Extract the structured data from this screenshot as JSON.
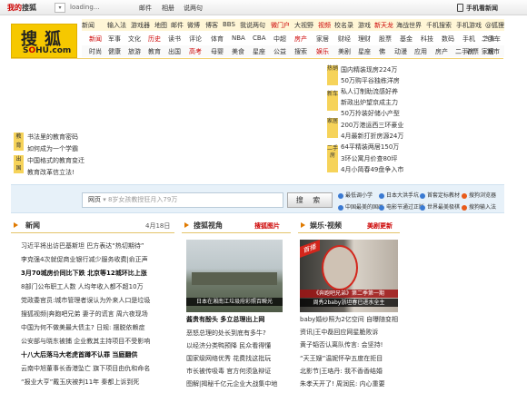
{
  "topbar": {
    "brand_red": "我的",
    "brand": "搜狐",
    "dropdown": "▾",
    "loading": "loading...",
    "links": [
      "邮件",
      "相册",
      "说两句"
    ],
    "mobile": "手机看新闻"
  },
  "logo": {
    "cn": "搜狐",
    "en_pre": "S",
    "en_o": "O",
    "en_post": "HU.com"
  },
  "nav": {
    "row1": [
      "新闻",
      "输入法",
      "游戏器",
      "地图",
      "邮件",
      "微博",
      "博客",
      "BBS",
      "我说两句",
      "微门户",
      "大视野",
      "视频",
      "校名录",
      "游戏",
      "新天龙",
      "海战世界",
      "千机搜索",
      "手机游戏",
      "@狐狸"
    ],
    "row2": [
      "新闻",
      "军事",
      "文化",
      "历史",
      "读书",
      "评论",
      "体育",
      "NBA",
      "CBA",
      "中超",
      "房产",
      "家居",
      "财经",
      "理财",
      "股票",
      "基金",
      "科技",
      "数码",
      "手机",
      "汽车",
      "二手车"
    ],
    "row3": [
      "时尚",
      "健康",
      "旅游",
      "教育",
      "出国",
      "高考",
      "母婴",
      "美食",
      "星座",
      "公益",
      "搜索",
      "娱乐",
      "美剧",
      "星座",
      "佛",
      "动漫",
      "应用",
      "房产",
      "二手房",
      "家居",
      "彩票",
      "城市"
    ]
  },
  "left_block": {
    "tag1": "教育",
    "tag2": "出国",
    "items": [
      "书法里的教育密码",
      "如何成为一个学霸",
      "中国格式的教育变迁",
      "教育改革信立法!"
    ]
  },
  "mid_block": {
    "tags": [
      "热销",
      "新车",
      "家居",
      "二手房"
    ],
    "items": [
      "国内精装现房224万",
      "50万购平谷独栋洋房",
      "私人订制助流感好养",
      "新政出炉望京成主力",
      "50万拎装好储小产型",
      "200万港运西三环豪业",
      "4月最新打折房源24万",
      "64平精装两居150万",
      "3环公寓月价查80坪",
      "4月小简春49盘争入市"
    ]
  },
  "search": {
    "scope": "网页",
    "placeholder": "8岁女孩教授狂月入79万",
    "button": "搜 索",
    "links": [
      "最低调小学",
      "日本大洪手坑",
      "首套定标教材",
      "搜狗浏览器",
      "中国最美的国画",
      "电影节通过正版",
      "世界最美极棋",
      "搜狗输入法"
    ]
  },
  "news_col": {
    "title": "新闻",
    "date": "4月18日",
    "items": [
      "习近平将出访巴基斯坦 巴方表达“热切期待”",
      "李克强4次就促商业银行减少服务收费|俞正声",
      "3月70城房价同比下跌 北京等12城环比上涨",
      "8部门公布职工人数 人均年收入都不超10万",
      "党政委官员:城市管理者误认为外来人口是垃圾",
      "搜狐视频|奔跑吧兄弟 妻子的谎言 周六夜现场",
      "中国为何不做美最大债主? 日规: 摆脱依赖症",
      "公安部与晓东被捕 企业教其主持项目不受影响",
      "十八大后落马大老虎首蹲不认罪 当庭翻供",
      "云南中旭董事长香港坠亡 旗下项目由仇和命名",
      "“报业大亨”戴玉庆被判11年 秦都上诉到死"
    ]
  },
  "video_col": {
    "title": "搜狐视角",
    "link": "搜狐图片",
    "caption": "日本在湘南江垃圾府彩照百瞬光",
    "headline": "酱贵有酚头 多立总理出上网",
    "lines": [
      "恶怒总理的处长到底有多牛?",
      "以经济分类鸭预降 民众看得懂",
      "国家级网络优秀 花费找这批玩",
      "市长被传吸毒 官方何须急辩证",
      "图解|揭秘千亿元企业大战集中地"
    ]
  },
  "ent_col": {
    "title": "娱乐·视频",
    "link": "美剧更新",
    "badge": "首播",
    "caption": "《奔跑吧兄弟》第二季第一期",
    "sub": "周秀2baby浙坦春已进水全主",
    "lines": [
      "baby婚纱照为2亿空间 自曝随变相",
      "资讯|王中磊回应网星脆败诉",
      "黄子韬否认离队传言: 会坚持!",
      "“天王嫂”温妮怀孕五度在拒目",
      "北影节|王珞丹: 我不香香结婚",
      "朱孝天开了! 周润民: 内心重要"
    ]
  }
}
